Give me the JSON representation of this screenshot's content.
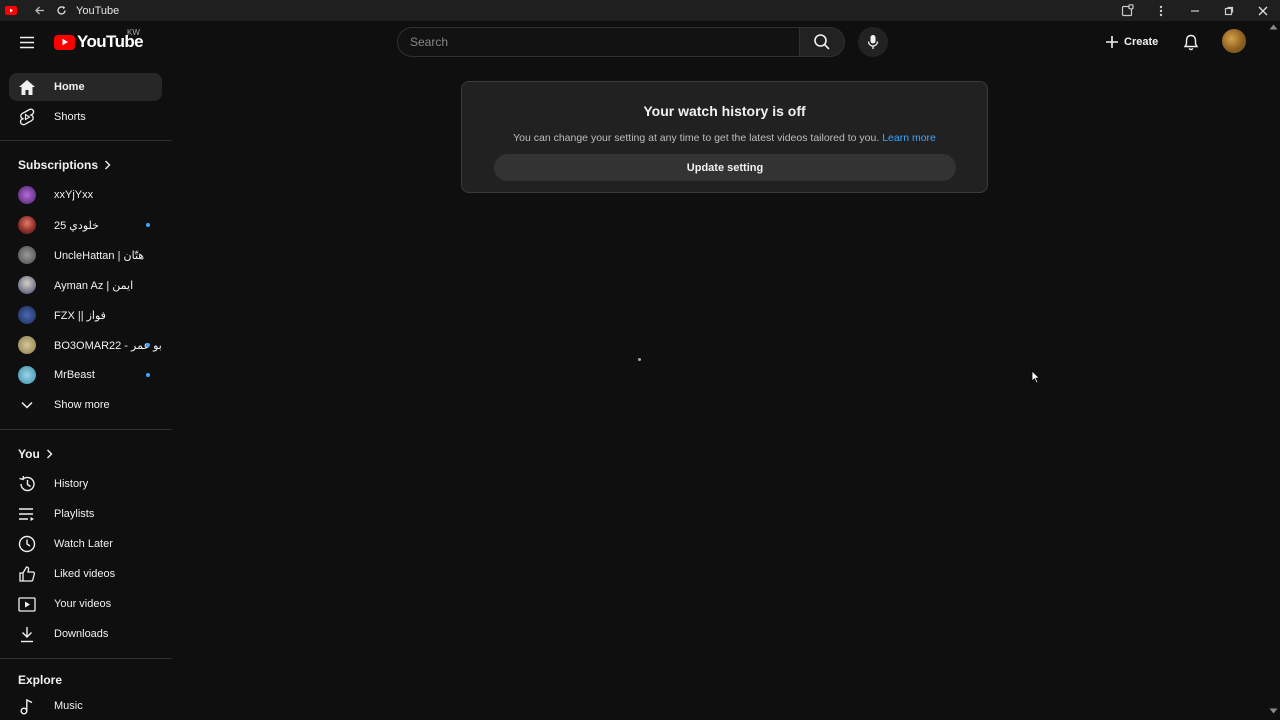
{
  "window": {
    "tab_title": "YouTube"
  },
  "masthead": {
    "logo_text": "YouTube",
    "country_code": "KW",
    "search_placeholder": "Search",
    "create_label": "Create"
  },
  "sidebar": {
    "main": [
      {
        "label": "Home",
        "icon": "home-icon",
        "active": true
      },
      {
        "label": "Shorts",
        "icon": "shorts-icon"
      }
    ],
    "subscriptions_title": "Subscriptions",
    "subscriptions": [
      {
        "label": "xxYjYxx",
        "new": false,
        "color": "#7a3fb0"
      },
      {
        "label": "خلودي 25",
        "new": true,
        "color": "#b0403a"
      },
      {
        "label": "UncleHattan | هتّان",
        "new": false,
        "color": "#6a6a6a"
      },
      {
        "label": "Ayman Az | ايمن",
        "new": false,
        "color": "#8a8fa0"
      },
      {
        "label": "FZX || فواز",
        "new": false,
        "color": "#2b4a8a"
      },
      {
        "label": "BO3OMAR22 - بو عمر",
        "new": true,
        "color": "#a89a6a"
      },
      {
        "label": "MrBeast",
        "new": true,
        "color": "#5ab0c8"
      }
    ],
    "show_more": "Show more",
    "you_title": "You",
    "you": [
      {
        "label": "History",
        "icon": "history-icon"
      },
      {
        "label": "Playlists",
        "icon": "playlists-icon"
      },
      {
        "label": "Watch Later",
        "icon": "clock-icon"
      },
      {
        "label": "Liked videos",
        "icon": "thumbs-up-icon"
      },
      {
        "label": "Your videos",
        "icon": "play-square-icon"
      },
      {
        "label": "Downloads",
        "icon": "download-icon"
      }
    ],
    "explore_title": "Explore",
    "explore": [
      {
        "label": "Music",
        "icon": "music-note-icon"
      }
    ]
  },
  "history_card": {
    "title": "Your watch history is off",
    "text": "You can change your setting at any time to get the latest videos tailored to you.",
    "link": "Learn more",
    "button": "Update setting"
  }
}
